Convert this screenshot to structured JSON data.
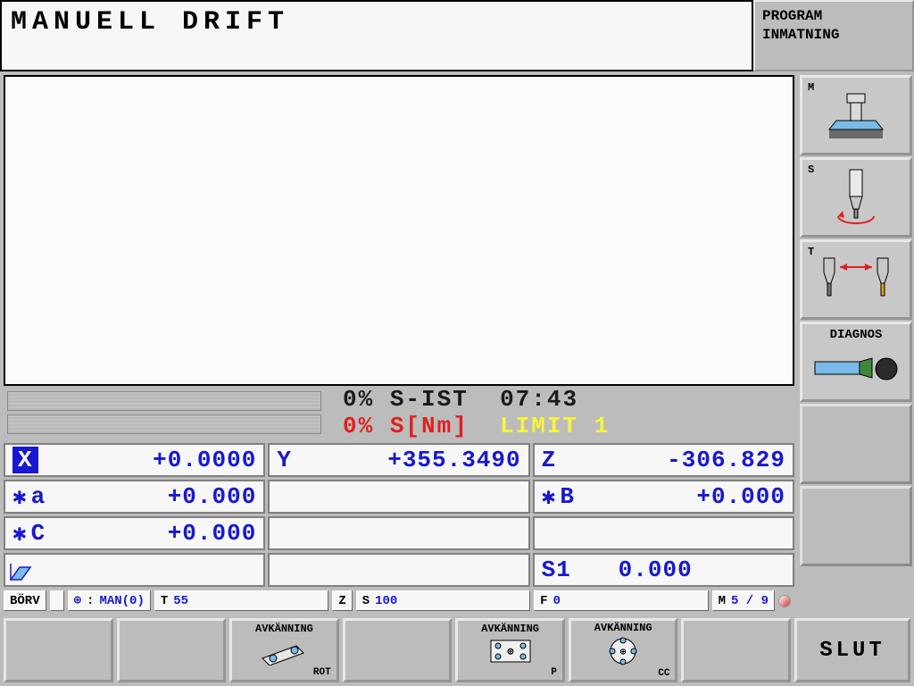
{
  "header": {
    "title": "MANUELL DRIFT",
    "mode_line1": "PROGRAM",
    "mode_line2": "INMATNING"
  },
  "status": {
    "line1_pct": "0%",
    "line1_label": "S-IST",
    "line1_time": "07:43",
    "line2_pct": "0%",
    "line2_label": "S[Nm]",
    "line2_limit": "LIMIT 1"
  },
  "axes": {
    "X": {
      "label": "X",
      "value": "+0.0000",
      "highlight": true
    },
    "Y": {
      "label": "Y",
      "value": "+355.3490"
    },
    "Z": {
      "label": "Z",
      "value": "-306.829"
    },
    "a": {
      "label": "a",
      "value": "+0.000",
      "prefix": "✱"
    },
    "B": {
      "label": "B",
      "value": "+0.000",
      "prefix": "✱"
    },
    "C": {
      "label": "C",
      "value": "+0.000",
      "prefix": "✱"
    },
    "S1": {
      "label": "S1",
      "value": "0.000"
    }
  },
  "status_row": {
    "borv": "BÖRV",
    "man": "MAN(0)",
    "t": "55",
    "z": "",
    "s": "100",
    "f": "0",
    "m": "5 / 9"
  },
  "softkeys": {
    "sk1": "",
    "sk2": "",
    "sk3": {
      "title": "AVKÄNNING",
      "sub": "ROT"
    },
    "sk4": "",
    "sk5": {
      "title": "AVKÄNNING",
      "sub": "P"
    },
    "sk6": {
      "title": "AVKÄNNING",
      "sub": "CC"
    },
    "sk7": "",
    "end": "SLUT"
  },
  "side": {
    "b1": "M",
    "b2": "S",
    "b3": "T",
    "b4": "DIAGNOS"
  }
}
